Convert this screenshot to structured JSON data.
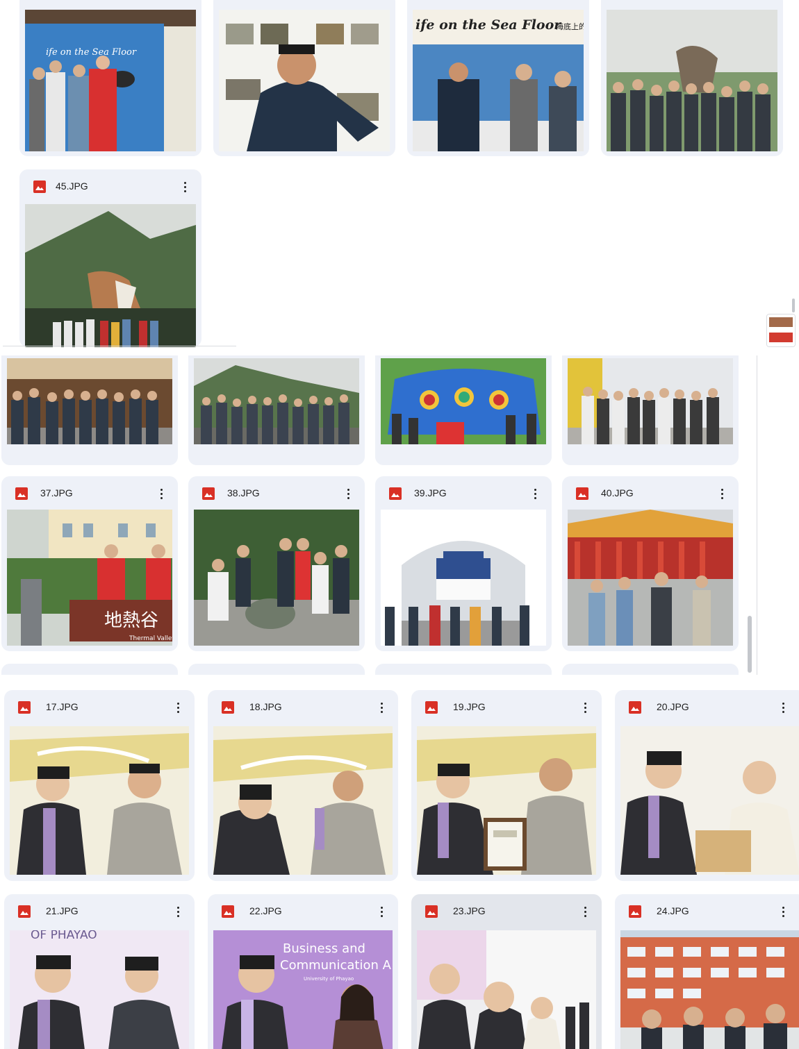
{
  "section_top": {
    "cards": [
      {
        "name": "",
        "scene": "exhibit"
      },
      {
        "name": "",
        "scene": "poster-man"
      },
      {
        "name": "",
        "scene": "exhibit-group"
      },
      {
        "name": "",
        "scene": "rock-group"
      },
      {
        "name": "45.JPG",
        "scene": "waterfall"
      }
    ],
    "exhibit_banner": "ife on the Sea Floor",
    "exhibit_banner_zh": "海底上的生命"
  },
  "section_middle": {
    "cards": [
      {
        "name": "",
        "scene": "street-group"
      },
      {
        "name": "",
        "scene": "hill-group"
      },
      {
        "name": "",
        "scene": "art-group"
      },
      {
        "name": "",
        "scene": "station-group"
      },
      {
        "name": "37.JPG",
        "scene": "thermal-valley"
      },
      {
        "name": "38.JPG",
        "scene": "bowl-group"
      },
      {
        "name": "39.JPG",
        "scene": "memorial-arch"
      },
      {
        "name": "40.JPG",
        "scene": "theater"
      }
    ],
    "thermal_sign_zh": "地熱谷",
    "thermal_sign_en": "Thermal Valley"
  },
  "section_bottom": {
    "cards": [
      {
        "name": "17.JPG",
        "scene": "ceremony-a"
      },
      {
        "name": "18.JPG",
        "scene": "ceremony-b"
      },
      {
        "name": "19.JPG",
        "scene": "ceremony-plaque"
      },
      {
        "name": "20.JPG",
        "scene": "ceremony-gift"
      },
      {
        "name": "21.JPG",
        "scene": "ceremony-c"
      },
      {
        "name": "22.JPG",
        "scene": "ceremony-d"
      },
      {
        "name": "23.JPG",
        "scene": "ceremony-e"
      },
      {
        "name": "24.JPG",
        "scene": "campus-group"
      }
    ],
    "slide_text_1": "Business and",
    "slide_text_2": "Communication A",
    "slide_text_3": "University of Phayao",
    "slide_text_4": "OF PHAYAO"
  },
  "colors": {
    "card_bg": "#eef1f8",
    "file_icon": "#d93025"
  }
}
